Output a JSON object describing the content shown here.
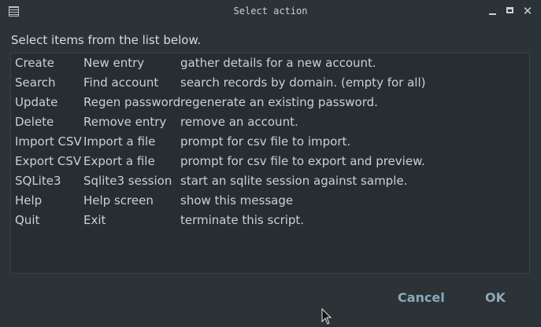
{
  "window": {
    "title": "Select action"
  },
  "prompt": "Select items from the list below.",
  "items": [
    {
      "name": "Create",
      "action": "New entry",
      "description": "gather details for a new account."
    },
    {
      "name": "Search",
      "action": "Find account",
      "description": "search records by domain. (empty for all)"
    },
    {
      "name": "Update",
      "action": "Regen password",
      "description": "regenerate an existing password."
    },
    {
      "name": "Delete",
      "action": "Remove entry",
      "description": "remove an account."
    },
    {
      "name": "Import CSV",
      "action": "Import a file",
      "description": "prompt for csv file to import."
    },
    {
      "name": "Export CSV",
      "action": "Export a file",
      "description": "prompt for csv file to export and preview."
    },
    {
      "name": "SQLite3",
      "action": "Sqlite3 session",
      "description": "start an sqlite session against sample."
    },
    {
      "name": "Help",
      "action": "Help screen",
      "description": "show this message"
    },
    {
      "name": "Quit",
      "action": "Exit",
      "description": "terminate this script."
    }
  ],
  "buttons": {
    "cancel": "Cancel",
    "ok": "OK"
  }
}
